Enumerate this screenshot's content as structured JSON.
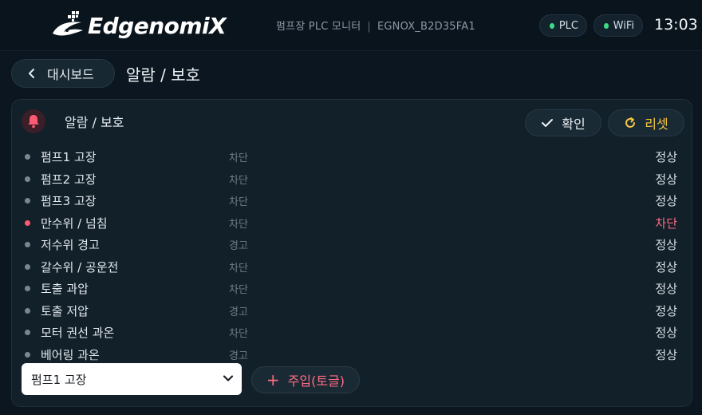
{
  "header": {
    "brand": "EdgenomiX",
    "site_name": "펌프장 PLC 모니터",
    "separator": "|",
    "device_id": "EGNOX_B2D35FA1",
    "status_plc": "PLC",
    "status_wifi": "WiFi",
    "clock": "13:03",
    "status_color": "#3ddc84"
  },
  "nav": {
    "back_label": "대시보드",
    "page_title": "알람 / 보호"
  },
  "panel": {
    "title": "알람 / 보호",
    "ack_label": "확인",
    "reset_label": "리셋",
    "alarms": [
      {
        "name": "펌프1 고장",
        "type": "차단",
        "state": "정상"
      },
      {
        "name": "펌프2 고장",
        "type": "차단",
        "state": "정상"
      },
      {
        "name": "펌프3 고장",
        "type": "차단",
        "state": "정상"
      },
      {
        "name": "만수위 / 넘침",
        "type": "차단",
        "state": "차단"
      },
      {
        "name": "저수위 경고",
        "type": "경고",
        "state": "정상"
      },
      {
        "name": "갈수위 / 공운전",
        "type": "차단",
        "state": "정상"
      },
      {
        "name": "토출 과압",
        "type": "차단",
        "state": "정상"
      },
      {
        "name": "토출 저압",
        "type": "경고",
        "state": "정상"
      },
      {
        "name": "모터 권선 과온",
        "type": "차단",
        "state": "정상"
      },
      {
        "name": "베어링 과온",
        "type": "경고",
        "state": "정상"
      }
    ],
    "inject_selected": "펌프1 고장",
    "inject_label": "주입(토글)",
    "alarm_color": "#ff5a73",
    "reset_color": "#f5c542"
  }
}
